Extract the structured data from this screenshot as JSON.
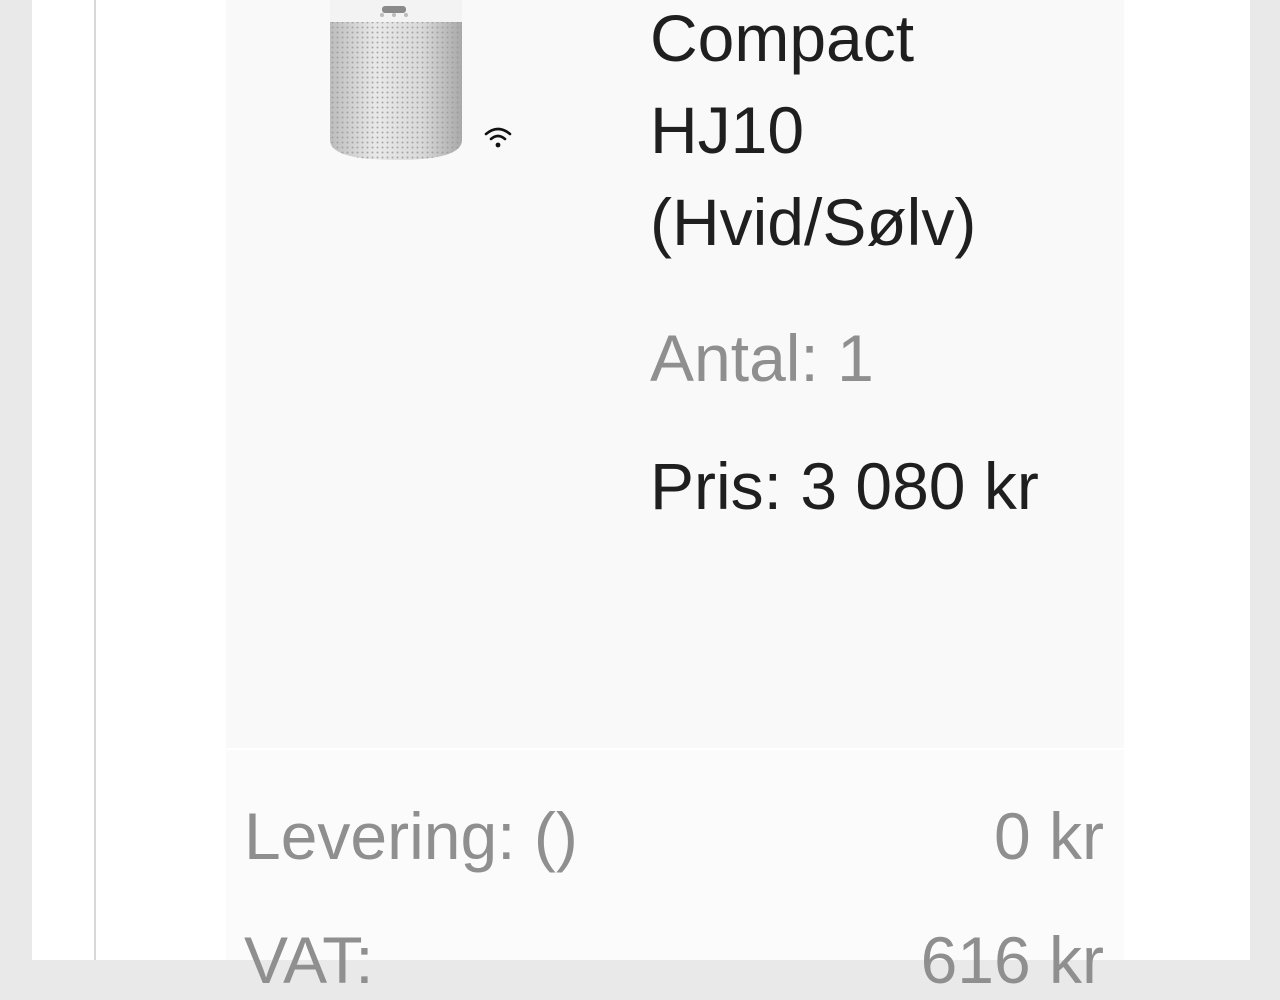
{
  "cart": {
    "item": {
      "name_lines": [
        "Compact",
        "HJ10",
        "(Hvid/Sølv)"
      ],
      "quantity_text": "Antal: 1",
      "price_text": "Pris: 3 080 kr",
      "image_icon": "air-purifier-image",
      "badge_icon": "wifi-icon"
    },
    "summary": {
      "delivery_label": "Levering: ()",
      "delivery_value": "0 kr",
      "vat_label": "VAT:",
      "vat_value": "616 kr"
    }
  },
  "colors": {
    "page_background": "#e9e9ea",
    "panel_background": "#f9f9f9",
    "text_primary": "#1f1f1f",
    "text_muted": "#8f8f8f"
  }
}
